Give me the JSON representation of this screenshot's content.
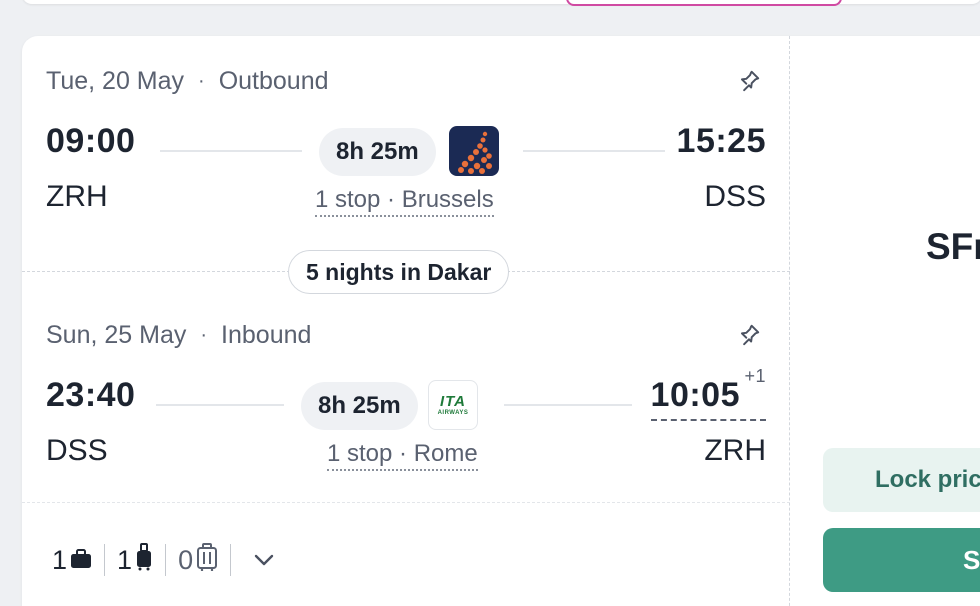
{
  "colors": {
    "accent_green": "#3e9b84",
    "lock_bg": "#e8f3f0",
    "top_tab_border": "#d04aa2",
    "text_primary": "#1d2430",
    "text_secondary": "#5a6170"
  },
  "outbound": {
    "date": "Tue, 20 May",
    "direction": "Outbound",
    "separator": "·",
    "departure_time": "09:00",
    "arrival_time": "15:25",
    "duration": "8h 25m",
    "origin": "ZRH",
    "destination": "DSS",
    "stops": "1 stop · Brussels",
    "airline_icon": "brussels-airlines-logo-icon"
  },
  "stay": {
    "label": "5 nights in Dakar"
  },
  "inbound": {
    "date": "Sun, 25 May",
    "direction": "Inbound",
    "separator": "·",
    "departure_time": "23:40",
    "arrival_time": "10:05",
    "day_offset": "+1",
    "duration": "8h 25m",
    "origin": "DSS",
    "destination": "ZRH",
    "stops": "1 stop · Rome",
    "airline_icon": "ita-airways-logo-icon",
    "airline_logo_text": "ITA",
    "airline_logo_subtext": "AIRWAYS"
  },
  "baggage": {
    "personal_item_count": "1",
    "carry_on_count": "1",
    "checked_bag_count": "0"
  },
  "price_panel": {
    "price": "SFr",
    "lock_label": "Lock pric",
    "select_label": "S"
  }
}
